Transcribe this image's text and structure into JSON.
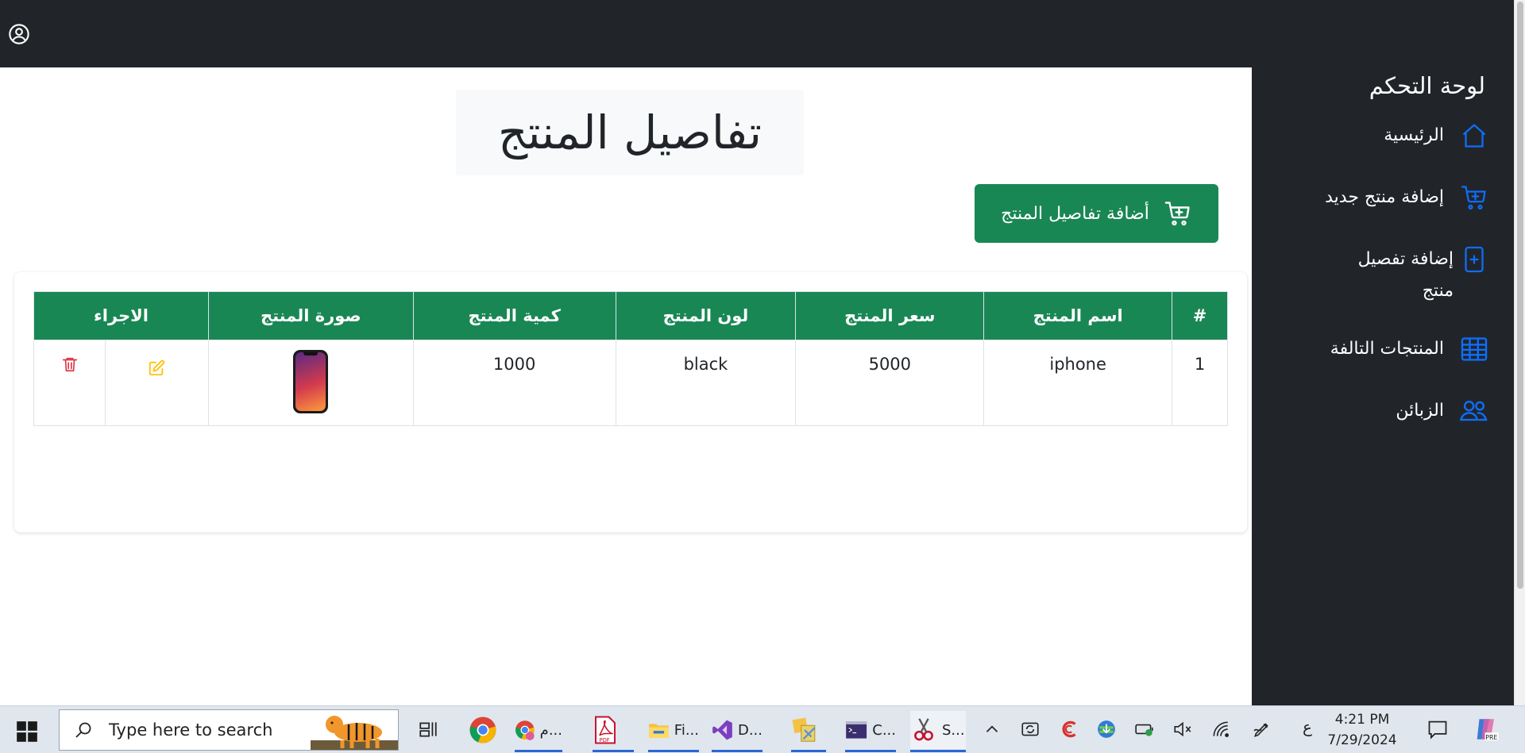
{
  "sidebar": {
    "title": "لوحة التحكم",
    "items": [
      {
        "label": "الرئيسية",
        "icon": "house-icon"
      },
      {
        "label": "إضافة منتج جديد",
        "icon": "cart-plus-icon"
      },
      {
        "label": "إضافة تفصيل منتج",
        "icon": "file-plus-icon"
      },
      {
        "label": "المنتجات التالفة",
        "icon": "table-icon"
      },
      {
        "label": "الزبائن",
        "icon": "people-icon"
      }
    ]
  },
  "main": {
    "page_title": "تفاصيل المنتج",
    "add_button_label": "أضافة تفاصيل المنتج",
    "table": {
      "headers": [
        "#",
        "اسم المنتج",
        "سعر المنتج",
        "لون المنتج",
        "كمية المنتج",
        "صورة المنتج",
        "الاجراء"
      ],
      "rows": [
        {
          "index": "1",
          "name": "iphone",
          "price": "5000",
          "color": "black",
          "quantity": "1000"
        }
      ]
    }
  },
  "taskbar": {
    "search_placeholder": "Type here to search",
    "apps": [
      {
        "label": "م...",
        "icon": "chrome-profile-icon"
      },
      {
        "label": "Fi...",
        "icon": "file-explorer-icon"
      },
      {
        "label": "D...",
        "icon": "visual-studio-icon"
      },
      {
        "label": "C...",
        "icon": "terminal-icon"
      },
      {
        "label": "S...",
        "icon": "snipping-tool-icon"
      }
    ],
    "language": "ع",
    "time": "4:21 PM",
    "date": "7/29/2024"
  },
  "colors": {
    "navbar": "#212529",
    "accent_green": "#198754",
    "link_blue": "#0d6efd",
    "edit_yellow": "#ffc107",
    "delete_red": "#dc3545"
  }
}
